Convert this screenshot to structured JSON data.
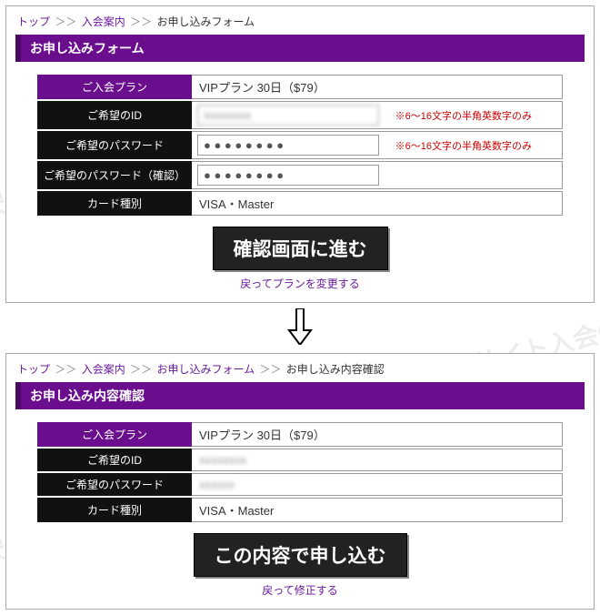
{
  "watermark_text": "安全性と評判で評判アダルトサイト入会体験",
  "form_panel": {
    "breadcrumb": {
      "top": "トップ",
      "guide": "入会案内",
      "current": "お申し込みフォーム"
    },
    "title": "お申し込みフォーム",
    "rows": {
      "plan_label": "ご入会プラン",
      "plan_value": "VIPプラン 30日（$79）",
      "id_label": "ご希望のID",
      "id_hint": "※6～16文字の半角英数字のみ",
      "pw_label": "ご希望のパスワード",
      "pw_mask": "● ● ● ● ● ● ● ●",
      "pw_hint": "※6～16文字の半角英数字のみ",
      "pw2_label": "ご希望のパスワード（確認）",
      "card_label": "カード種別",
      "card_value": "VISA・Master"
    },
    "proceed_button": "確認画面に進む",
    "back_link": "戻ってプランを変更する"
  },
  "confirm_panel": {
    "breadcrumb": {
      "top": "トップ",
      "guide": "入会案内",
      "form": "お申し込みフォーム",
      "current": "お申し込み内容確認"
    },
    "title": "お申し込み内容確認",
    "rows": {
      "plan_label": "ご入会プラン",
      "plan_value": "VIPプラン 30日（$79）",
      "id_label": "ご希望のID",
      "pw_label": "ご希望のパスワード",
      "card_label": "カード種別",
      "card_value": "VISA・Master"
    },
    "submit_button": "この内容で申し込む",
    "back_link": "戻って修正する"
  }
}
